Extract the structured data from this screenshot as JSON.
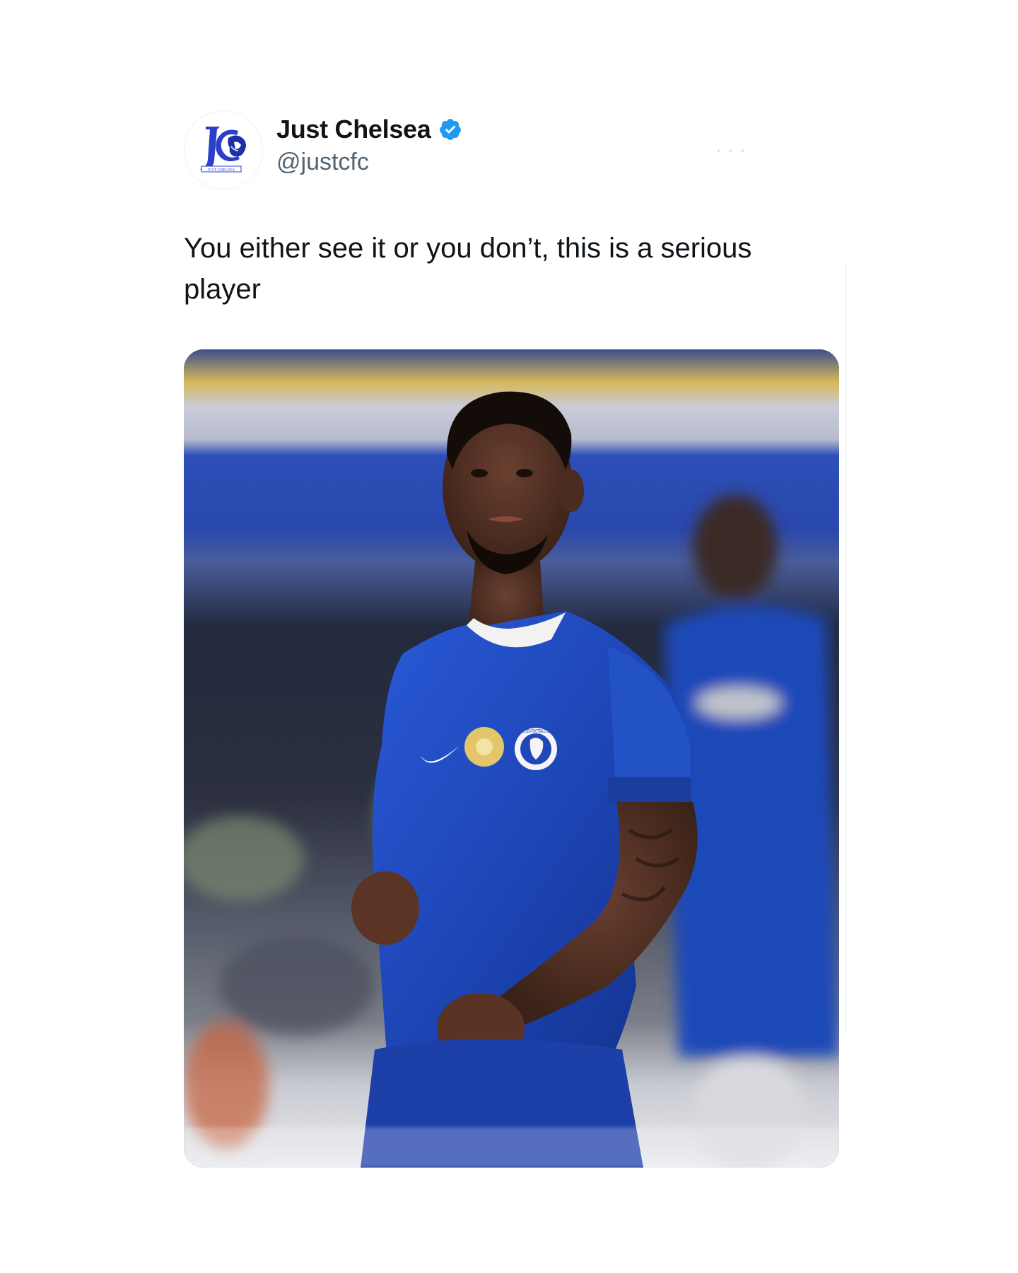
{
  "author": {
    "display_name": "Just Chelsea",
    "handle": "@justcfc",
    "verified": true,
    "avatar_icon": "just-chelsea-lion-logo",
    "avatar_logo_text": "JUST CHELSEA"
  },
  "tweet": {
    "text": "You either see it or you don’t, this is a serious player"
  },
  "media": {
    "kind": "photo",
    "subject": "footballer-in-chelsea-home-kit",
    "crest_text": "CHELSEA FOOTBALL CLUB"
  },
  "colors": {
    "verified_blue": "#1d9bf0",
    "text_primary": "#0f1419",
    "text_secondary": "#536471",
    "chelsea_blue": "#1f47b8"
  }
}
